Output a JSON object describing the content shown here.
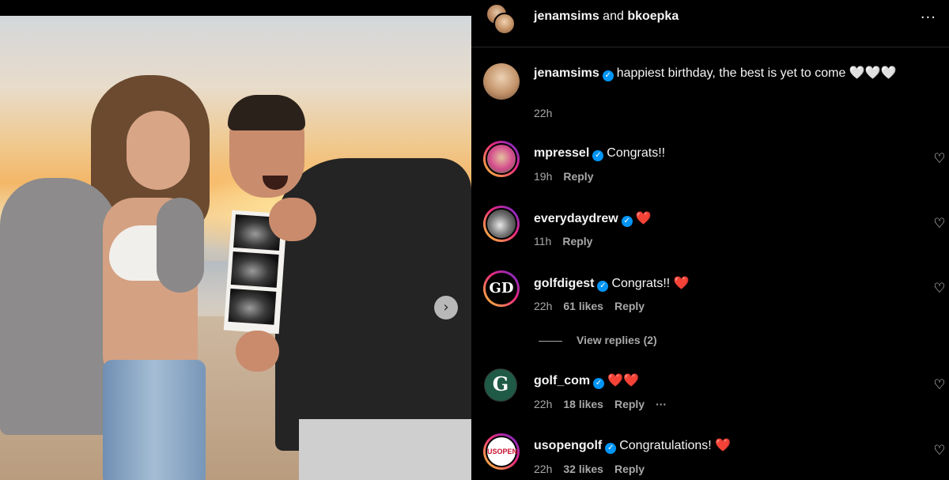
{
  "post": {
    "image_alt": "Couple on beach at sunset holding ultrasound photos",
    "next_icon": "chevron-right-icon",
    "next_glyph": "›"
  },
  "header": {
    "author1": "jenamsims",
    "joiner": " and ",
    "author2": "bkoepka",
    "more_glyph": "···"
  },
  "caption": {
    "user": "jenamsims",
    "text": "happiest birthday, the best is yet to come",
    "hearts": "🤍🤍🤍",
    "time": "22h"
  },
  "comments": [
    {
      "user": "mpressel",
      "text": "Congrats!!",
      "emoji": "",
      "time": "19h",
      "likes": "",
      "reply": "Reply"
    },
    {
      "user": "everydaydrew",
      "text": "",
      "emoji": "❤️",
      "time": "11h",
      "likes": "",
      "reply": "Reply"
    },
    {
      "user": "golfdigest",
      "text": "Congrats!!",
      "emoji": "❤️",
      "time": "22h",
      "likes": "61 likes",
      "reply": "Reply",
      "avatar_text": "GD"
    },
    {
      "user": "golf_com",
      "text": "",
      "emoji": "❤️❤️",
      "time": "22h",
      "likes": "18 likes",
      "reply": "Reply",
      "more": "···",
      "avatar_text": "G"
    },
    {
      "user": "usopengolf",
      "text": "Congratulations!",
      "emoji": "❤️",
      "time": "22h",
      "likes": "32 likes",
      "reply": "Reply",
      "avatar_text": "USOPEN"
    }
  ],
  "view_replies": "View replies (2)",
  "verified_glyph": "✓",
  "like_glyph": "♡",
  "colors": {
    "verified": "#0095f6",
    "secondary_text": "#a8a8a8",
    "heart_red": "#ff3040",
    "background": "#000000"
  }
}
